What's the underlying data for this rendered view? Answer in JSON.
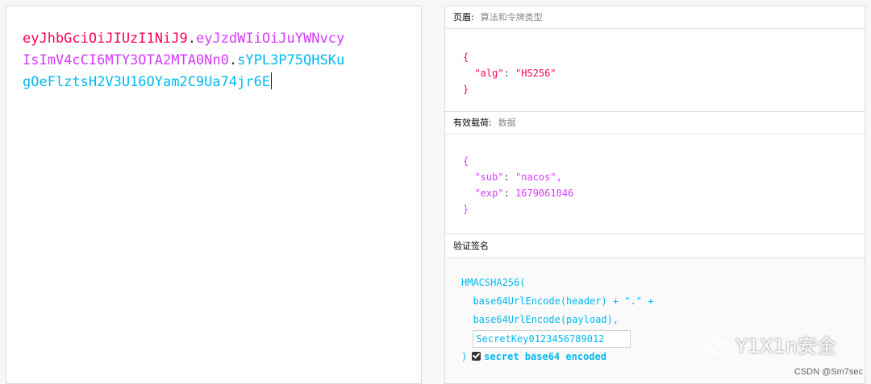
{
  "token": {
    "line1_header": "eyJhbGciOiJIUzI1NiJ9",
    "line1_dot": ".",
    "line1_payload": "eyJzdWIiOiJuYWNvcy",
    "line2_payload": "IsImV4cCI6MTY3OTA2MTA0Nn0",
    "line2_dot": ".",
    "line2_sig": "sYPL3P75QHSKu",
    "line3_sig": "gOeFlztsH2V3U16OYam2C9Ua74jr6E"
  },
  "header_section": {
    "title": "页眉:",
    "subtitle": "算法和令牌类型",
    "open": "{",
    "key": "\"alg\"",
    "colon": ": ",
    "value": "\"HS256\"",
    "close": "}"
  },
  "payload_section": {
    "title": "有效载荷:",
    "subtitle": "数据",
    "open": "{",
    "sub_key": "\"sub\"",
    "sub_colon": ": ",
    "sub_value": "\"nacos\",",
    "exp_key": "\"exp\"",
    "exp_colon": ": ",
    "exp_value": "1679061046",
    "close": "}"
  },
  "signature_section": {
    "title": "验证签名",
    "line1": "HMACSHA256(",
    "line2": "  base64UrlEncode(header) + \".\" +",
    "line3": "  base64UrlEncode(payload),",
    "secret_value": "SecretKey0123456789012",
    "close": ")",
    "checkbox_label": "secret base64 encoded",
    "checkbox_checked": true
  },
  "watermark": {
    "text": "Y1X1n安全",
    "icon": "wechat-icon"
  },
  "credit": "CSDN @Sm7sec"
}
